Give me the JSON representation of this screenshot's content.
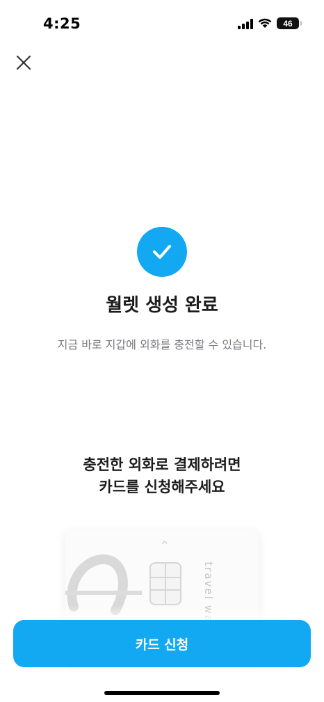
{
  "status_bar": {
    "time": "4:25",
    "battery_level": "46",
    "icons": [
      "signal-icon",
      "wifi-icon",
      "battery-icon"
    ]
  },
  "header": {
    "close_icon": "close-icon"
  },
  "success": {
    "icon": "check-icon",
    "title": "월렛 생성 완료",
    "subtitle": "지금 바로 지갑에 외화를 충전할 수 있습니다."
  },
  "promo": {
    "line1": "충전한 외화로 결제하려면",
    "line2": "카드를 신청해주세요"
  },
  "card": {
    "brand_text": "travel wallet"
  },
  "footer": {
    "apply_label": "카드 신청"
  },
  "colors": {
    "accent": "#12a8f2",
    "text": "#1c1c1e",
    "subtle": "#7a7a80"
  }
}
